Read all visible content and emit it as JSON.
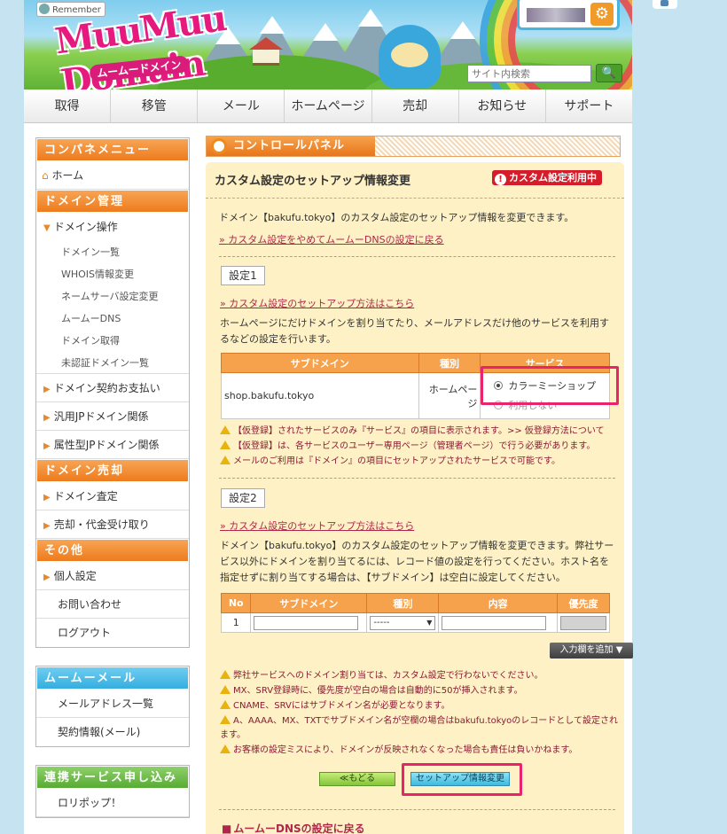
{
  "header": {
    "remember_label": "Remember",
    "logo_text": "MuuMuu Domain",
    "logo_sub": "ムームードメイン",
    "search_placeholder": "サイト内検索",
    "search_button": "🔍"
  },
  "nav": [
    "取得",
    "移管",
    "メール",
    "ホームページ",
    "売却",
    "お知らせ",
    "サポート"
  ],
  "sidebar": {
    "control_menu_title": "コンパネメニュー",
    "home": "ホーム",
    "domain_mgmt_title": "ドメイン管理",
    "domain_ops": "ドメイン操作",
    "domain_ops_items": [
      "ドメイン一覧",
      "WHOIS情報変更",
      "ネームサーバ設定変更",
      "ムームーDNS",
      "ドメイン取得",
      "未認証ドメイン一覧"
    ],
    "contract_payment": "ドメイン契約お支払い",
    "generic_jp": "汎用JPドメイン関係",
    "attribute_jp": "属性型JPドメイン関係",
    "domain_sale_title": "ドメイン売却",
    "domain_appraisal": "ドメイン査定",
    "sale_payment": "売却・代金受け取り",
    "other_title": "その他",
    "personal_settings": "個人設定",
    "contact": "お問い合わせ",
    "logout": "ログアウト",
    "mail_title": "ムームーメール",
    "mail_items": [
      "メールアドレス一覧",
      "契約情報(メール)"
    ],
    "partner_title": "連携サービス申し込み",
    "partner_items": [
      "ロリポップ！"
    ]
  },
  "control_panel_title": "コントロールパネル",
  "main": {
    "title": "カスタム設定のセットアップ情報変更",
    "badge": "カスタム設定利用中",
    "intro": "ドメイン【bakufu.tokyo】のカスタム設定のセットアップ情報を変更できます。",
    "quit_link": "カスタム設定をやめてムームーDNSの設定に戻る",
    "setting1": {
      "label": "設定1",
      "howto_link": "カスタム設定のセットアップ方法はこちら",
      "desc": "ホームページにだけドメインを割り当てたり、メールアドレスだけ他のサービスを利用するなどの設定を行います。",
      "headers": [
        "サブドメイン",
        "種別",
        "サービス"
      ],
      "row": {
        "subdomain": "shop.bakufu.tokyo",
        "type": "ホームページ",
        "option_selected": "カラーミーショップ",
        "option_unused": "利用しない"
      },
      "notes": [
        "【仮登録】されたサービスのみ『サービス』の項目に表示されます。>> 仮登録方法について",
        "【仮登録】は、各サービスのユーザー専用ページ（管理者ページ）で行う必要があります。",
        "メールのご利用は『ドメイン』の項目にセットアップされたサービスで可能です。"
      ]
    },
    "setting2": {
      "label": "設定2",
      "howto_link": "カスタム設定のセットアップ方法はこちら",
      "desc": "ドメイン【bakufu.tokyo】のカスタム設定のセットアップ情報を変更できます。弊社サービス以外にドメインを割り当てるには、レコード値の設定を行ってください。ホスト名を指定せずに割り当てする場合は、【サブドメイン】は空白に設定してください。",
      "headers": [
        "No",
        "サブドメイン",
        "種別",
        "内容",
        "優先度"
      ],
      "row": {
        "no": "1",
        "type_value": "-----"
      },
      "add_button": "入力欄を追加",
      "notes": [
        "弊社サービスへのドメイン割り当ては、カスタム設定で行わないでください。",
        "MX、SRV登録時に、優先度が空白の場合は自動的に50が挿入されます。",
        "CNAME、SRVにはサブドメイン名が必要となります。",
        "A、AAAA、MX、TXTでサブドメイン名が空欄の場合はbakufu.tokyoのレコードとして設定されます。",
        "お客様の設定ミスにより、ドメインが反映されなくなった場合も責任は負いかねます。"
      ]
    },
    "back_button": "≪もどる",
    "submit_button": "セットアップ情報変更",
    "bottom_link": "ムームーDNSの設定に戻る"
  }
}
